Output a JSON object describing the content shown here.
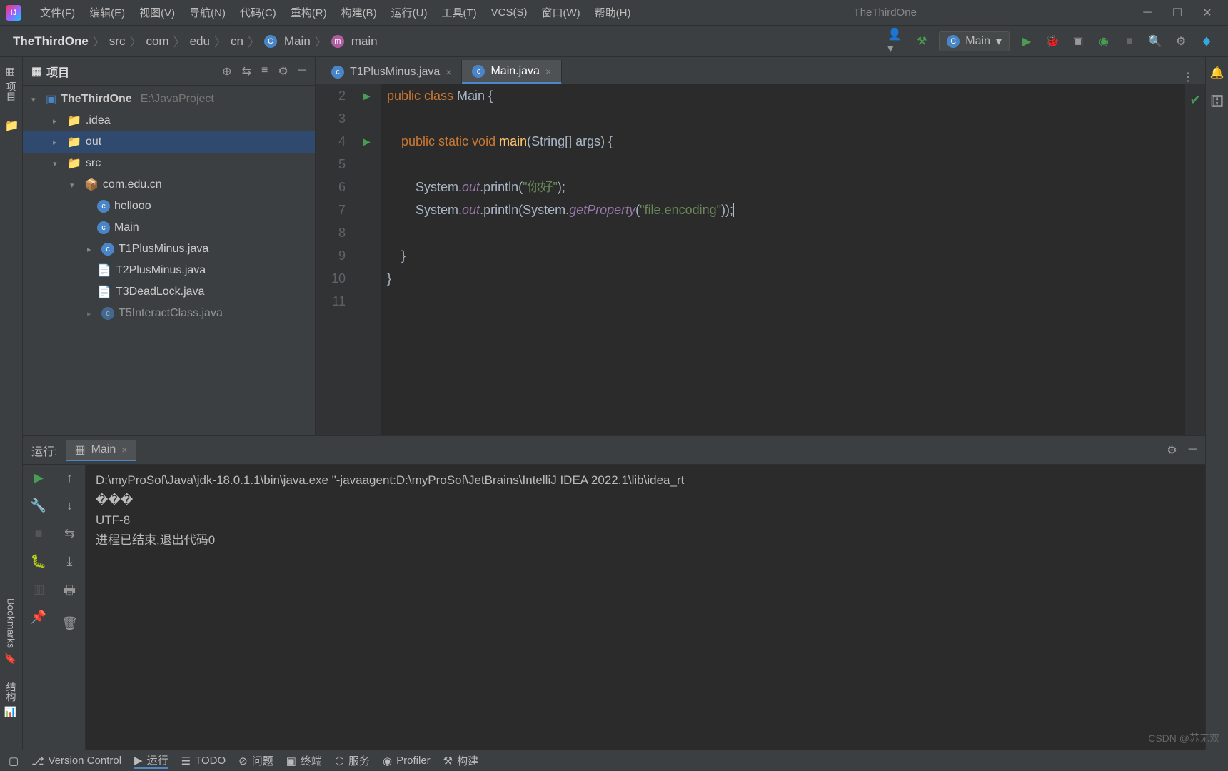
{
  "title": "TheThirdOne",
  "menus": [
    "文件(F)",
    "编辑(E)",
    "视图(V)",
    "导航(N)",
    "代码(C)",
    "重构(R)",
    "构建(B)",
    "运行(U)",
    "工具(T)",
    "VCS(S)",
    "窗口(W)",
    "帮助(H)"
  ],
  "breadcrumb": {
    "project": "TheThirdOne",
    "src": "src",
    "pkg1": "com",
    "pkg2": "edu",
    "pkg3": "cn",
    "cls": "Main",
    "method": "main"
  },
  "run_config_label": "Main",
  "left_rail": {
    "project": "项目",
    "bookmarks": "Bookmarks",
    "structure": "结构"
  },
  "panel": {
    "title": "项目"
  },
  "tree": {
    "root": "TheThirdOne",
    "root_path": "E:\\JavaProject",
    "idea": ".idea",
    "out": "out",
    "src": "src",
    "pkg": "com.edu.cn",
    "hello": "hellooo",
    "main": "Main",
    "t1": "T1PlusMinus.java",
    "t2": "T2PlusMinus.java",
    "t3": "T3DeadLock.java",
    "t5": "T5InteractClass.java"
  },
  "tabs": {
    "t0": "T1PlusMinus.java",
    "t1": "Main.java"
  },
  "code": {
    "l2": "public class Main {",
    "l4": "    public static void main(String[] args) {",
    "l6a": "        System.",
    "l6b": "out",
    "l6c": ".println(",
    "l6d": "\"你好\"",
    "l6e": ");",
    "l7a": "        System.",
    "l7b": "out",
    "l7c": ".println(System.",
    "l7d": "getProperty",
    "l7e": "(",
    "l7f": "\"file.encoding\"",
    "l7g": "));",
    "l9": "    }",
    "l10": "}",
    "lines": [
      "2",
      "3",
      "4",
      "5",
      "6",
      "7",
      "8",
      "9",
      "10",
      "11"
    ]
  },
  "run": {
    "label": "运行:",
    "tab": "Main",
    "line1": "D:\\myProSof\\Java\\jdk-18.0.1.1\\bin\\java.exe \"-javaagent:D:\\myProSof\\JetBrains\\IntelliJ IDEA 2022.1\\lib\\idea_rt",
    "line2": "���",
    "line3": "UTF-8",
    "line4": "",
    "line5": "进程已结束,退出代码0"
  },
  "status": {
    "vcs": "Version Control",
    "run": "运行",
    "todo": "TODO",
    "problems": "问题",
    "terminal": "终端",
    "services": "服务",
    "profiler": "Profiler",
    "build": "构建"
  },
  "watermark": "CSDN @苏无双"
}
